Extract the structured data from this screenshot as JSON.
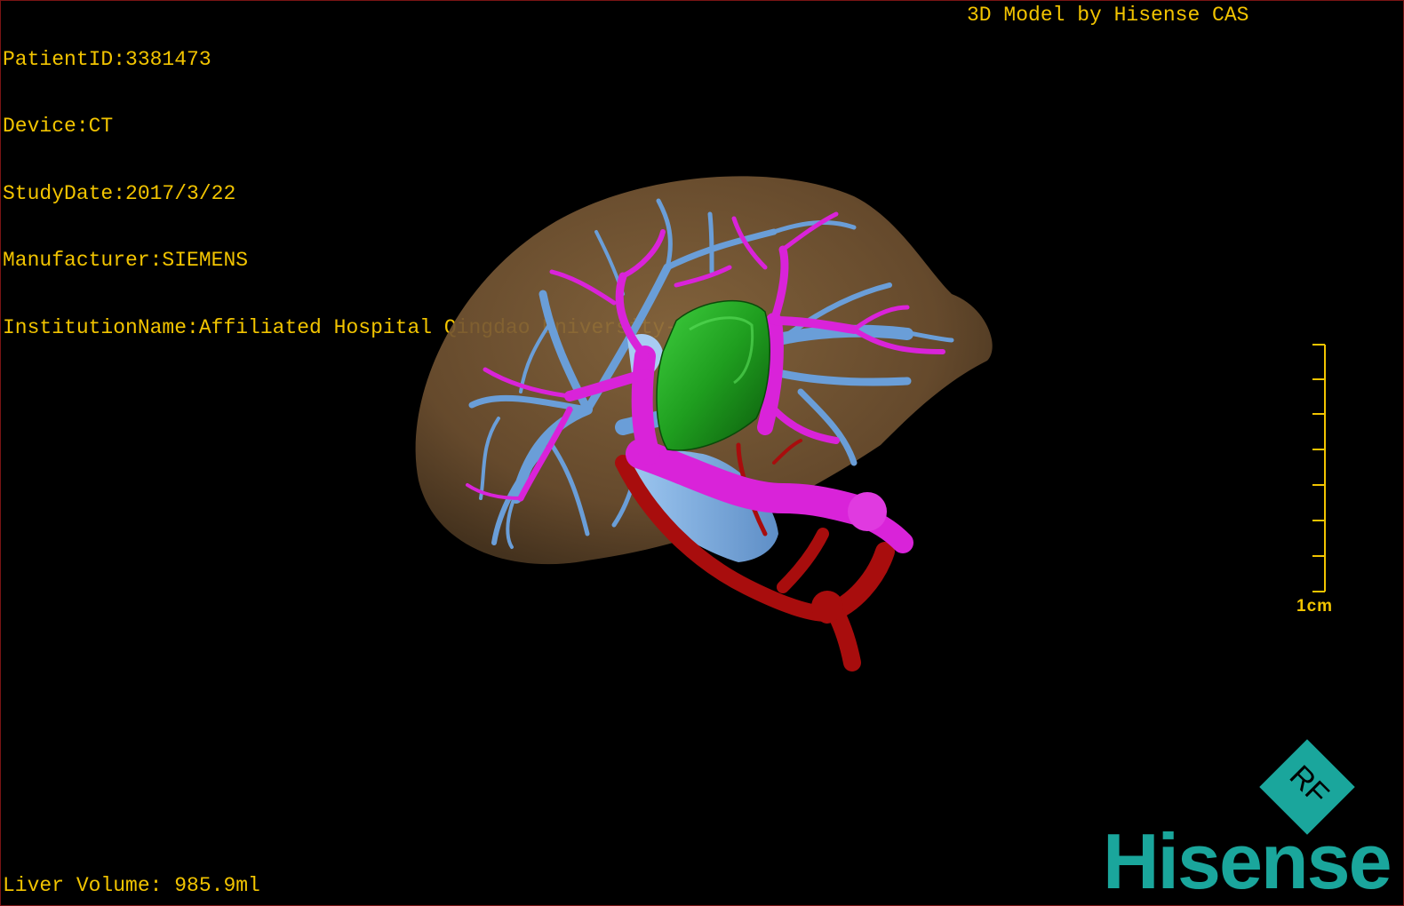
{
  "overlay": {
    "patient_id": "PatientID:3381473",
    "device": "Device:CT",
    "study_date": "StudyDate:2017/3/22",
    "manufacturer": "Manufacturer:SIEMENS",
    "institution": "InstitutionName:Affiliated Hospital Qingdao University-C",
    "model_credit": "3D Model by Hisense CAS",
    "liver_volume": "Liver Volume: 985.9ml"
  },
  "scale": {
    "label": "1cm"
  },
  "logo": {
    "badge_text": "RF",
    "wordmark": "Hisense"
  },
  "colors": {
    "overlay_text": "#f2c400",
    "liver": "#7a5a34",
    "portal_vein": "#d923d9",
    "hepatic_vein": "#6a9ed8",
    "artery": "#a80d0d",
    "tumor": "#1f9e1f",
    "brand": "#1aa69c"
  }
}
